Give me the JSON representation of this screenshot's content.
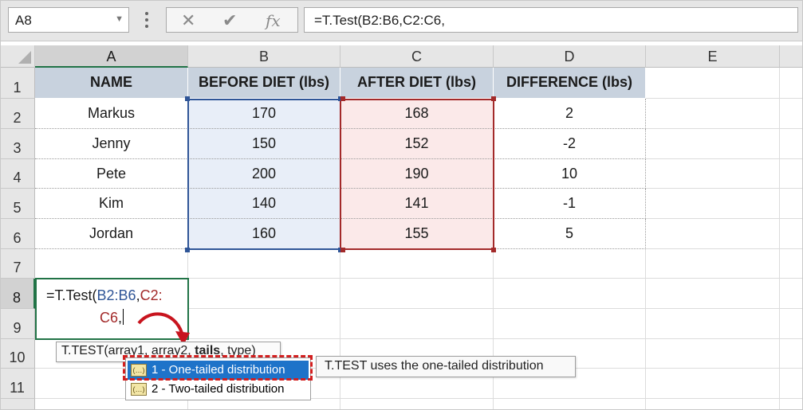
{
  "formula_bar": {
    "name_box": "A8",
    "cancel_glyph": "✕",
    "enter_glyph": "✔",
    "fx_glyph": "fx",
    "formula": "=T.Test(B2:B6,C2:C6,"
  },
  "columns": [
    "A",
    "B",
    "C",
    "D",
    "E"
  ],
  "rows": [
    "1",
    "2",
    "3",
    "4",
    "5",
    "6",
    "7",
    "8",
    "9",
    "10",
    "11"
  ],
  "table": {
    "headers": [
      "NAME",
      "BEFORE DIET (lbs)",
      "AFTER DIET (lbs)",
      "DIFFERENCE (lbs)"
    ],
    "rows": [
      [
        "Markus",
        "170",
        "168",
        "2"
      ],
      [
        "Jenny",
        "150",
        "152",
        "-2"
      ],
      [
        "Pete",
        "200",
        "190",
        "10"
      ],
      [
        "Kim",
        "140",
        "141",
        "-1"
      ],
      [
        "Jordan",
        "160",
        "155",
        "5"
      ]
    ]
  },
  "edit_cell": {
    "prefix": "=T.Test(",
    "arg1": "B2:B6",
    "sep1": ",",
    "arg2_line1": "C2:",
    "arg2_line2": "C6",
    "sep2": ","
  },
  "tooltip": {
    "func": "T.TEST(",
    "arg1": "array1",
    "sep1": ", ",
    "arg2": "array2",
    "sep2": ", ",
    "arg3": "tails",
    "sep3": ", ",
    "arg4": "type",
    "close": ")"
  },
  "dropdown": {
    "options": [
      {
        "label": "1 - One-tailed distribution",
        "icon": "(…)"
      },
      {
        "label": "2 - Two-tailed distribution",
        "icon": "(…)"
      }
    ],
    "selected_index": 0,
    "description": "T.TEST uses the one-tailed distribution"
  },
  "colors": {
    "header_fill": "#c8d2de",
    "range_b": "#2f5597",
    "range_c": "#a32a2a",
    "selection": "#1e73c9",
    "highlight_dash": "#d21f1f",
    "active_cell": "#217346"
  }
}
